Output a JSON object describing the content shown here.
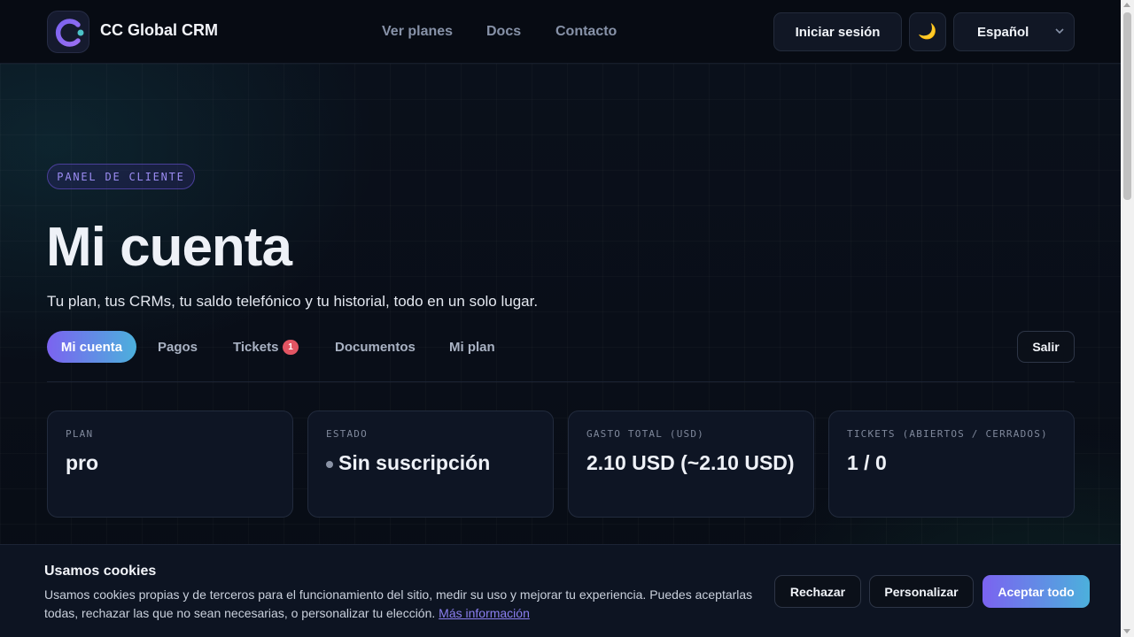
{
  "header": {
    "brand": "CC Global CRM",
    "nav": [
      "Ver planes",
      "Docs",
      "Contacto"
    ],
    "login_label": "Iniciar sesión",
    "theme_icon": "🌙",
    "language": "Español"
  },
  "hero": {
    "pill": "PANEL DE CLIENTE",
    "title": "Mi cuenta",
    "subtitle": "Tu plan, tus CRMs, tu saldo telefónico y tu historial, todo en un solo lugar."
  },
  "tabs": {
    "active": "Mi cuenta",
    "items": [
      "Pagos",
      "Tickets",
      "Documentos",
      "Mi plan"
    ],
    "tickets_badge": "1",
    "logout": "Salir"
  },
  "cards": [
    {
      "label": "PLAN",
      "value": "pro"
    },
    {
      "label": "ESTADO",
      "value": "Sin suscripción"
    },
    {
      "label": "GASTO TOTAL (USD)",
      "value": "2.10 USD (~2.10 USD)"
    },
    {
      "label": "TICKETS (ABIERTOS / CERRADOS)",
      "value": "1 / 0"
    }
  ],
  "cookies": {
    "title": "Usamos cookies",
    "text": "Usamos cookies propias y de terceros para el funcionamiento del sitio, medir su uso y mejorar tu experiencia. Puedes aceptarlas todas, rechazar las que no sean necesarias, o personalizar tu elección.",
    "link": "Más información",
    "reject": "Rechazar",
    "customize": "Personalizar",
    "accept": "Aceptar todo"
  },
  "colors": {
    "accent_start": "#7b63f0",
    "accent_end": "#4cb0dc",
    "badge": "#e25563"
  }
}
